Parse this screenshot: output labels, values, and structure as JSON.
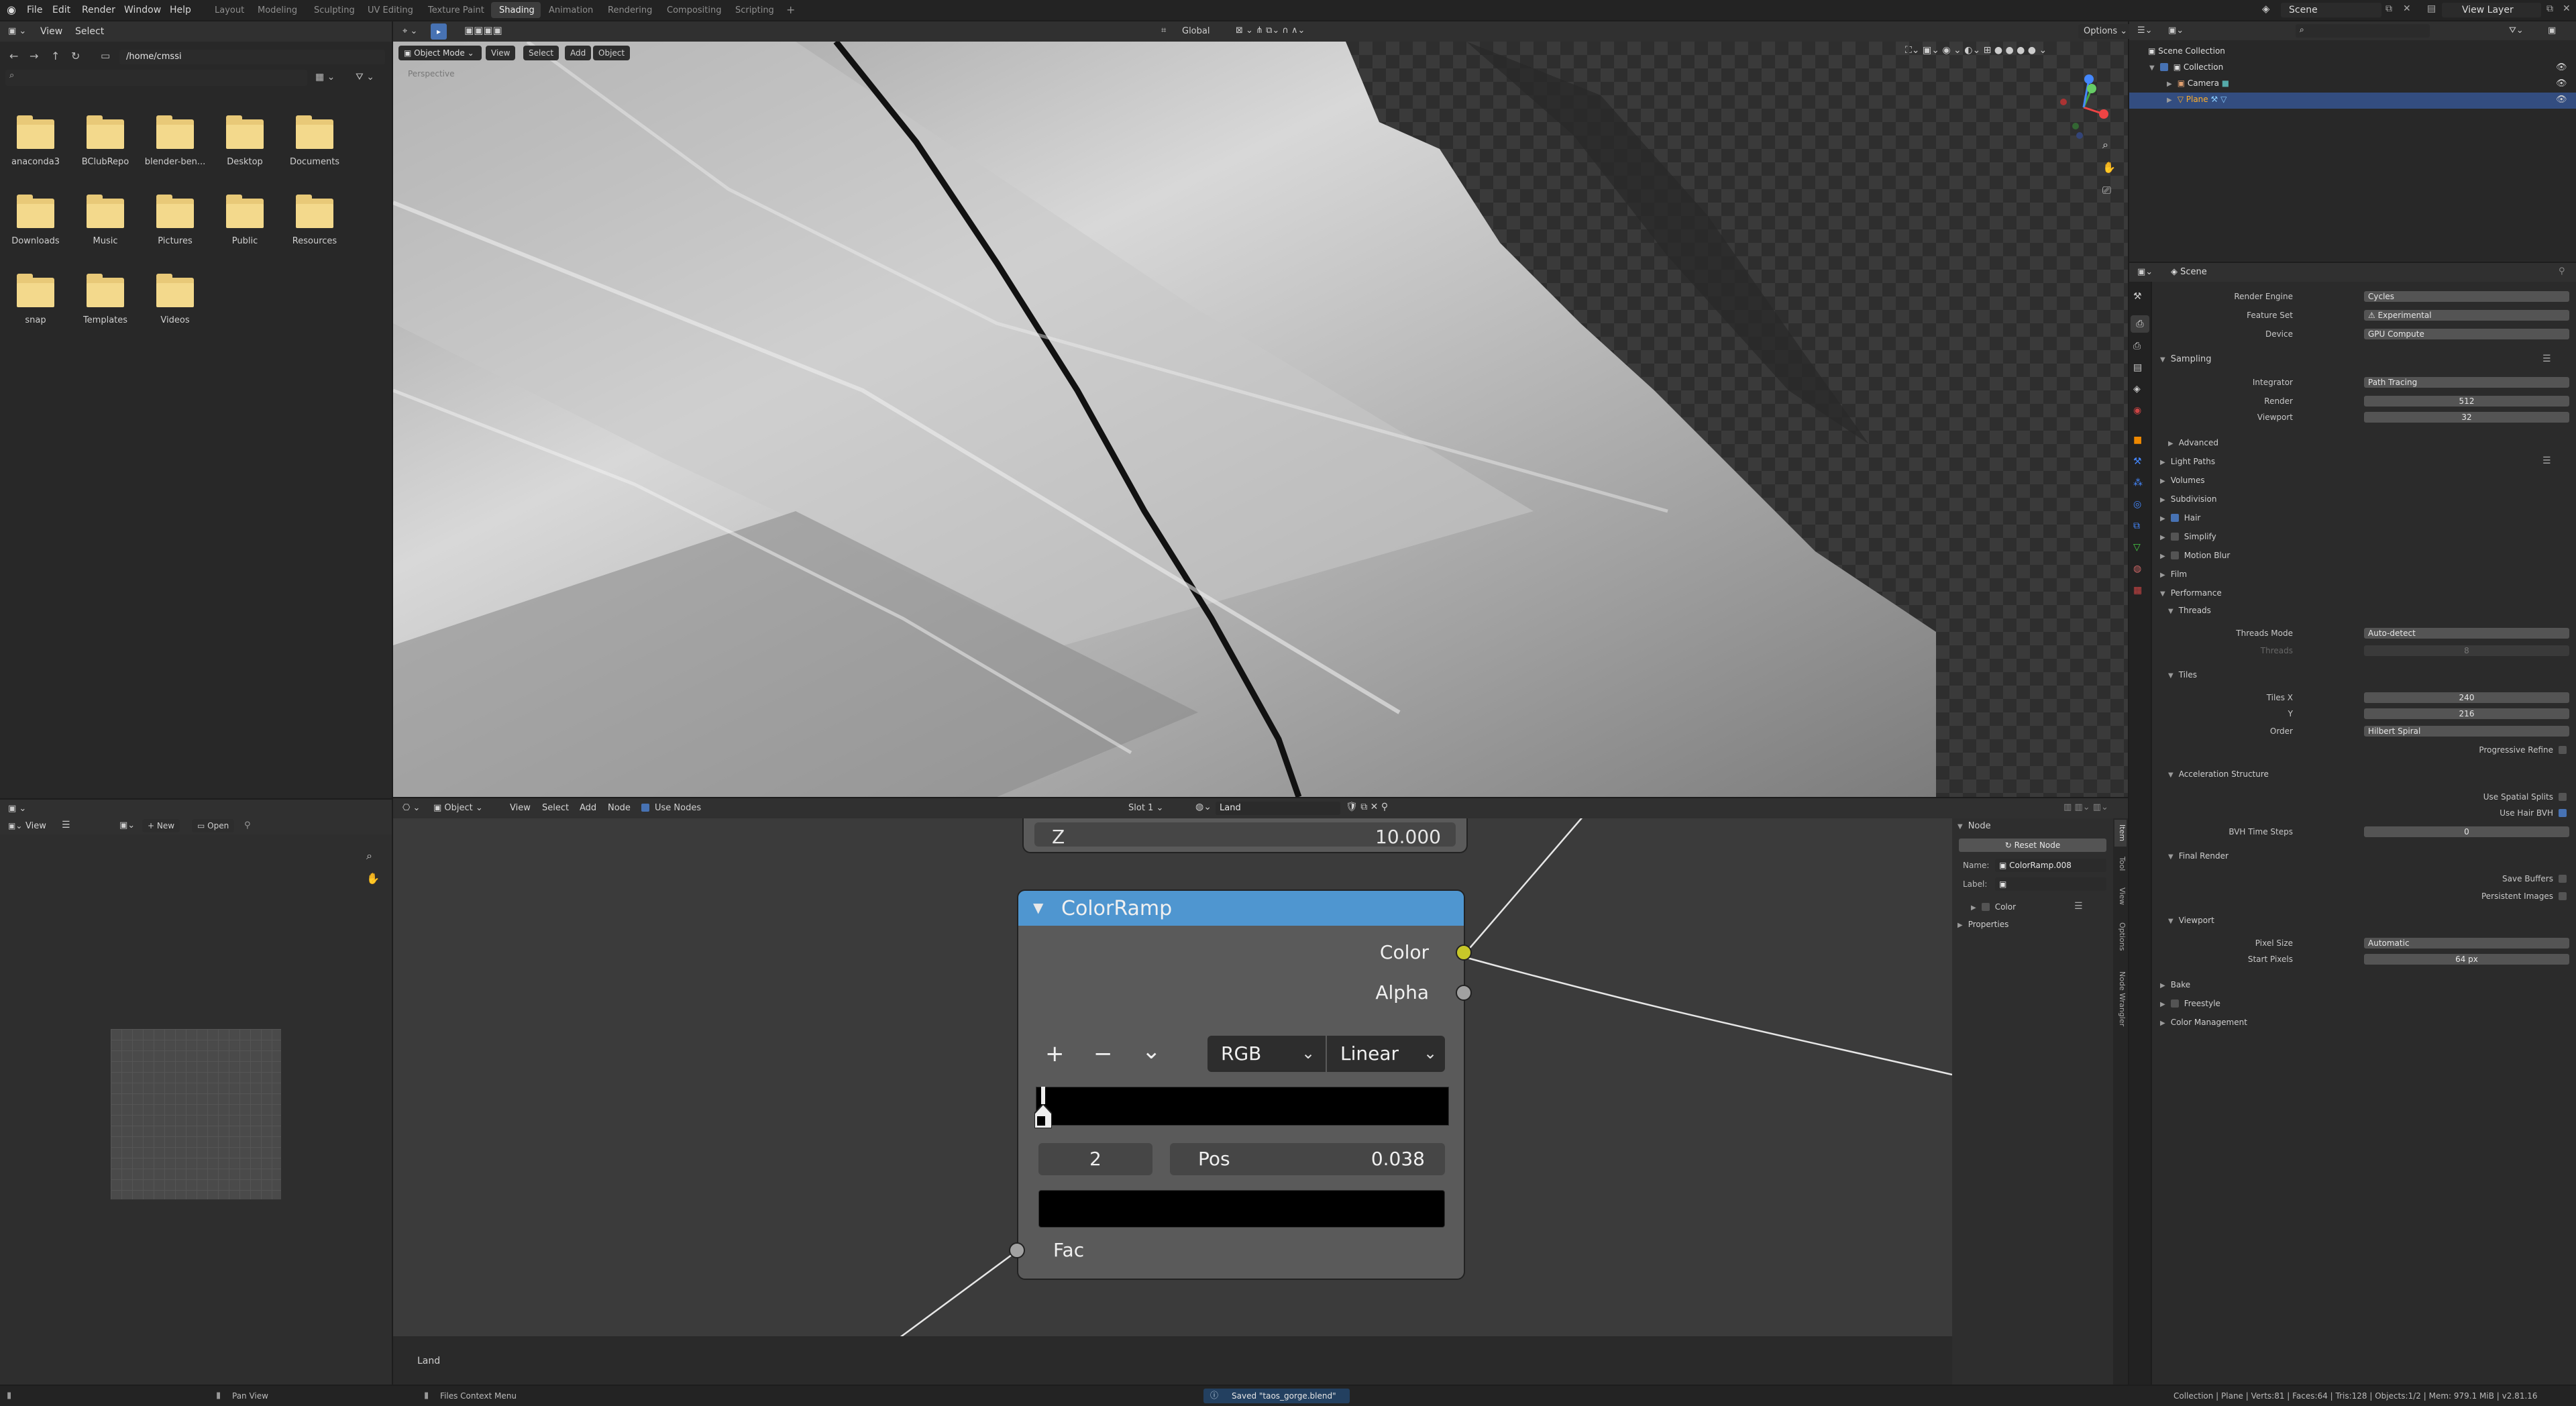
{
  "topbar": {
    "menus": [
      "File",
      "Edit",
      "Render",
      "Window",
      "Help"
    ],
    "workspaces": [
      "Layout",
      "Modeling",
      "Sculpting",
      "UV Editing",
      "Texture Paint",
      "Shading",
      "Animation",
      "Rendering",
      "Compositing",
      "Scripting"
    ],
    "active_workspace": "Shading",
    "add_tab": "+",
    "scene_label": "Scene",
    "view_layer_label": "View Layer"
  },
  "filebrowser": {
    "menus": [
      "View",
      "Select"
    ],
    "path": "/home/cmssi",
    "folders": [
      "anaconda3",
      "BClubRepo",
      "blender-ben...",
      "Desktop",
      "Documents",
      "Downloads",
      "Music",
      "Pictures",
      "Public",
      "Resources",
      "snap",
      "Templates",
      "Videos"
    ]
  },
  "image_editor": {
    "view": "View",
    "new": "New",
    "open": "Open"
  },
  "viewport": {
    "mode": "Object Mode",
    "menus": [
      "View",
      "Select",
      "Add",
      "Object"
    ],
    "orientation": "Global",
    "options": "Options",
    "corner_text": "Perspective"
  },
  "node_editor": {
    "object_type": "Object",
    "menus": [
      "View",
      "Select",
      "Add",
      "Node"
    ],
    "use_nodes": "Use Nodes",
    "slot": "Slot 1",
    "material": "Land",
    "footer_label": "Land",
    "z_label": "Z",
    "z_value": "10.000",
    "colorramp": {
      "title": "ColorRamp",
      "out_color": "Color",
      "out_alpha": "Alpha",
      "add": "+",
      "remove": "−",
      "more": "⌄",
      "mode": "RGB",
      "interp": "Linear",
      "index": "2",
      "pos_label": "Pos",
      "pos_value": "0.038",
      "in_fac": "Fac"
    },
    "sidebar": {
      "header": "Node",
      "reset": "Reset Node",
      "name_label": "Name:",
      "name_value": "ColorRamp.008",
      "label_label": "Label:",
      "color": "Color",
      "properties": "Properties",
      "tabs": [
        "Item",
        "Tool",
        "View",
        "Options",
        "Node Wrangler"
      ]
    }
  },
  "outliner": {
    "root": "Scene Collection",
    "items": [
      "Collection",
      "Camera",
      "Plane"
    ]
  },
  "properties": {
    "scene": "Scene",
    "render_engine_label": "Render Engine",
    "render_engine": "Cycles",
    "feature_set_label": "Feature Set",
    "feature_set": "Experimental",
    "device_label": "Device",
    "device": "GPU Compute",
    "sampling": "Sampling",
    "integrator_label": "Integrator",
    "integrator": "Path Tracing",
    "render_label": "Render",
    "render_val": "512",
    "viewport_label": "Viewport",
    "viewport_val": "32",
    "advanced": "Advanced",
    "light_paths": "Light Paths",
    "volumes": "Volumes",
    "subdivision": "Subdivision",
    "hair": "Hair",
    "simplify": "Simplify",
    "motion_blur": "Motion Blur",
    "film": "Film",
    "performance": "Performance",
    "threads": "Threads",
    "threads_mode_label": "Threads Mode",
    "threads_mode": "Auto-detect",
    "threads_label": "Threads",
    "threads_val": "8",
    "tiles": "Tiles",
    "tiles_x_label": "Tiles X",
    "tiles_x": "240",
    "tiles_y_label": "Y",
    "tiles_y": "216",
    "order_label": "Order",
    "order": "Hilbert Spiral",
    "progressive_refine": "Progressive Refine",
    "accel": "Acceleration Structure",
    "use_spatial_splits": "Use Spatial Splits",
    "use_hair_bvh": "Use Hair BVH",
    "bvh_time_steps_label": "BVH Time Steps",
    "bvh_time_steps": "0",
    "final_render": "Final Render",
    "save_buffers": "Save Buffers",
    "persistent_images": "Persistent Images",
    "viewport_sec": "Viewport",
    "pixel_size_label": "Pixel Size",
    "pixel_size": "Automatic",
    "start_pixels_label": "Start Pixels",
    "start_pixels": "64 px",
    "bake": "Bake",
    "freestyle": "Freestyle",
    "color_management": "Color Management"
  },
  "statusbar": {
    "pan": "Pan View",
    "context": "Files Context Menu",
    "saved": "Saved \"taos_gorge.blend\"",
    "stats": "Collection | Plane | Verts:81 | Faces:64 | Tris:128 | Objects:1/2 | Mem: 979.1 MiB | v2.81.16"
  },
  "colors": {
    "accent": "#4772b3",
    "node_header": "#4f96d0",
    "socket_yellow": "#c7c729",
    "socket_grey": "#a1a1a1",
    "panel_bg": "#303030",
    "node_bg": "#5a5a5a"
  }
}
